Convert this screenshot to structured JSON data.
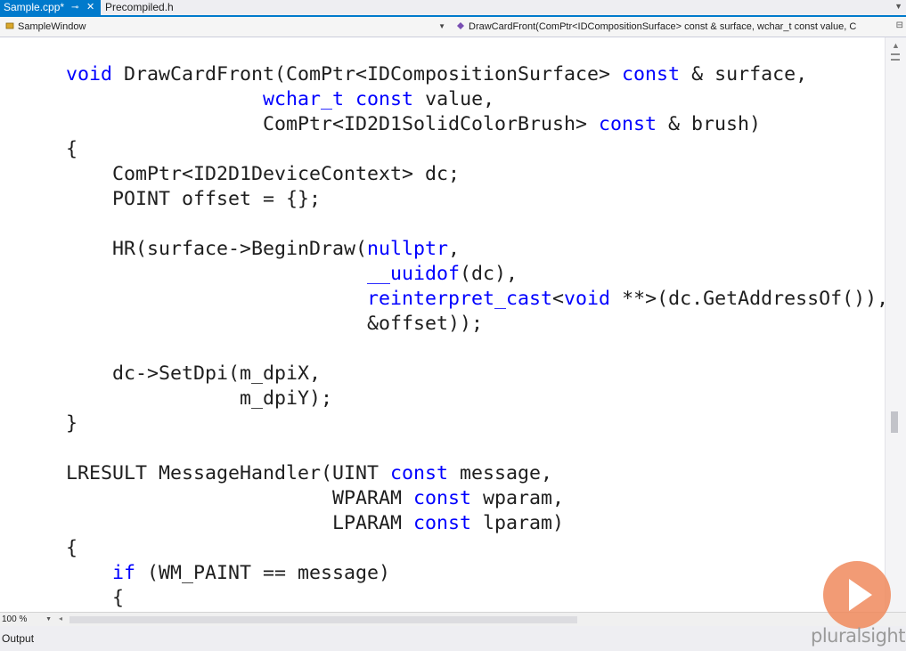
{
  "tabs": [
    {
      "label": "Sample.cpp*",
      "active": true
    },
    {
      "label": "Precompiled.h",
      "active": false
    }
  ],
  "navbar": {
    "left_label": "SampleWindow",
    "right_label": "DrawCardFront(ComPtr<IDCompositionSurface> const & surface, wchar_t const value, C"
  },
  "code": {
    "lines": [
      [
        {
          "t": "void",
          "c": "kw"
        },
        {
          "t": " DrawCardFront(ComPtr<IDCompositionSurface> "
        },
        {
          "t": "const",
          "c": "kw"
        },
        {
          "t": " & surface,"
        }
      ],
      [
        {
          "t": "                 "
        },
        {
          "t": "wchar_t",
          "c": "kw"
        },
        {
          "t": " "
        },
        {
          "t": "const",
          "c": "kw"
        },
        {
          "t": " value,"
        }
      ],
      [
        {
          "t": "                 ComPtr<ID2D1SolidColorBrush> "
        },
        {
          "t": "const",
          "c": "kw"
        },
        {
          "t": " & brush)"
        }
      ],
      [
        {
          "t": "{"
        }
      ],
      [
        {
          "t": "    ComPtr<ID2D1DeviceContext> dc;"
        }
      ],
      [
        {
          "t": "    POINT offset = {};"
        }
      ],
      [
        {
          "t": ""
        }
      ],
      [
        {
          "t": "    HR(surface->BeginDraw("
        },
        {
          "t": "nullptr",
          "c": "kw"
        },
        {
          "t": ","
        }
      ],
      [
        {
          "t": "                          "
        },
        {
          "t": "__uuidof",
          "c": "kw"
        },
        {
          "t": "(dc),"
        }
      ],
      [
        {
          "t": "                          "
        },
        {
          "t": "reinterpret_cast",
          "c": "kw"
        },
        {
          "t": "<"
        },
        {
          "t": "void",
          "c": "kw"
        },
        {
          "t": " **>(dc.GetAddressOf()),"
        }
      ],
      [
        {
          "t": "                          &offset));"
        }
      ],
      [
        {
          "t": ""
        }
      ],
      [
        {
          "t": "    dc->SetDpi(m_dpiX,"
        }
      ],
      [
        {
          "t": "               m_dpiY);"
        }
      ],
      [
        {
          "t": "}"
        }
      ],
      [
        {
          "t": ""
        }
      ],
      [
        {
          "t": "LRESULT MessageHandler(UINT "
        },
        {
          "t": "const",
          "c": "kw"
        },
        {
          "t": " message,"
        }
      ],
      [
        {
          "t": "                       WPARAM "
        },
        {
          "t": "const",
          "c": "kw"
        },
        {
          "t": " wparam,"
        }
      ],
      [
        {
          "t": "                       LPARAM "
        },
        {
          "t": "const",
          "c": "kw"
        },
        {
          "t": " lparam)"
        }
      ],
      [
        {
          "t": "{"
        }
      ],
      [
        {
          "t": "    "
        },
        {
          "t": "if",
          "c": "kw"
        },
        {
          "t": " (WM_PAINT == message)"
        }
      ],
      [
        {
          "t": "    {"
        }
      ]
    ]
  },
  "zoom": {
    "value": "100 %"
  },
  "output": {
    "title": "Output"
  },
  "watermark": {
    "brand": "pluralsight"
  },
  "colors": {
    "accent": "#007acc",
    "keyword": "#0000ff",
    "text": "#1e1e1e",
    "watermark_orange": "#f08a5d"
  },
  "icons": {
    "tab_pin": "pin-icon",
    "tab_close": "close-icon",
    "nav_class": "class-icon",
    "nav_method": "method-icon",
    "play": "play-icon"
  }
}
